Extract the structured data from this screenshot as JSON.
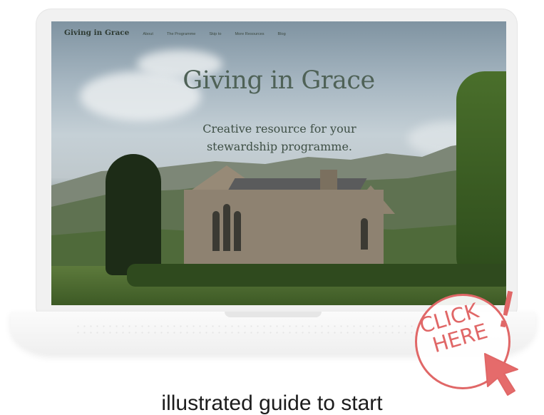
{
  "nav": {
    "logo": "Giving in Grace",
    "links": [
      "About",
      "The Programme",
      "Skip to",
      "More Resources",
      "Blog"
    ]
  },
  "hero": {
    "title": "Giving in Grace",
    "subtitle_line1": "Creative resource for your",
    "subtitle_line2": "stewardship programme."
  },
  "badge": {
    "line1": "CLICK",
    "line2": "HERE",
    "exclaim": "!",
    "color": "#e06767"
  },
  "caption": "illustrated guide to start"
}
